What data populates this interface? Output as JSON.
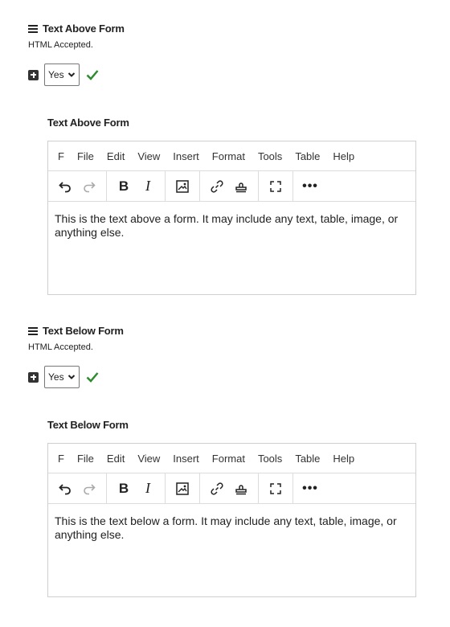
{
  "sections": [
    {
      "title": "Text Above Form",
      "hint": "HTML Accepted.",
      "select_value": "Yes",
      "editor_label": "Text Above Form",
      "content": "This is the text above a form. It may include any text, table, image, or anything else."
    },
    {
      "title": "Text Below Form",
      "hint": "HTML Accepted.",
      "select_value": "Yes",
      "editor_label": "Text Below Form",
      "content": "This is the text below a form. It may include any text, table, image, or anything else."
    }
  ],
  "editor": {
    "menu": [
      "F",
      "File",
      "Edit",
      "View",
      "Insert",
      "Format",
      "Tools",
      "Table",
      "Help"
    ],
    "toolbar": {
      "bold_label": "B",
      "italic_label": "I",
      "more_label": "•••"
    }
  },
  "colors": {
    "check": "#2e8b2e",
    "border": "#cfcfcf"
  }
}
